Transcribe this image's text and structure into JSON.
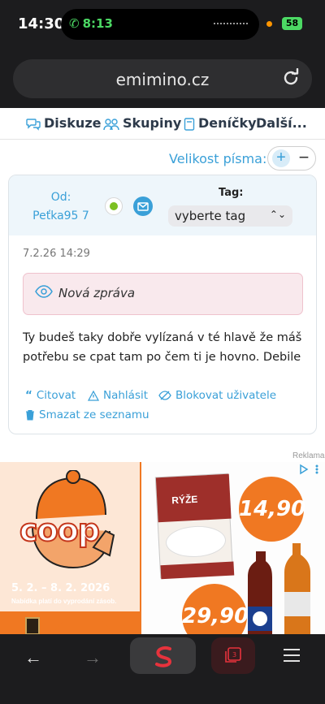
{
  "status_bar": {
    "time": "14:30",
    "call_time": "8:13",
    "battery": "58"
  },
  "browser": {
    "url": "emimino.cz"
  },
  "nav": {
    "items": [
      "Diskuze",
      "Skupiny",
      "Deníčky",
      "Další..."
    ]
  },
  "font_size": {
    "label": "Velikost písma:",
    "plus": "+",
    "minus": "−"
  },
  "post": {
    "author": "Od: Peťka95 7",
    "tag_label": "Tag:",
    "tag_select_value": "vyberte tag",
    "date": "7.2.26 14:29",
    "new_message": "Nová zpráva",
    "body": "Ty budeš taky dobře vylízaná v té hlavě že máš potřebu se cpat tam po čem ti je hovno. Debile",
    "actions": {
      "quote": "Citovat",
      "report": "Nahlásit",
      "block": "Blokovat uživatele",
      "remove": "Smazat ze seznamu"
    }
  },
  "ad": {
    "label": "Reklama",
    "brand": "coop",
    "dates": "5. 2. – 8. 2. 2026",
    "note": "Nabídka platí do vyprodání zásob.",
    "price1": "14,90",
    "price2": "29,90",
    "product": "RÝŽE"
  },
  "colors": {
    "accent": "#3aa0d8",
    "ad_orange": "#f07822",
    "online": "#7cc022"
  }
}
